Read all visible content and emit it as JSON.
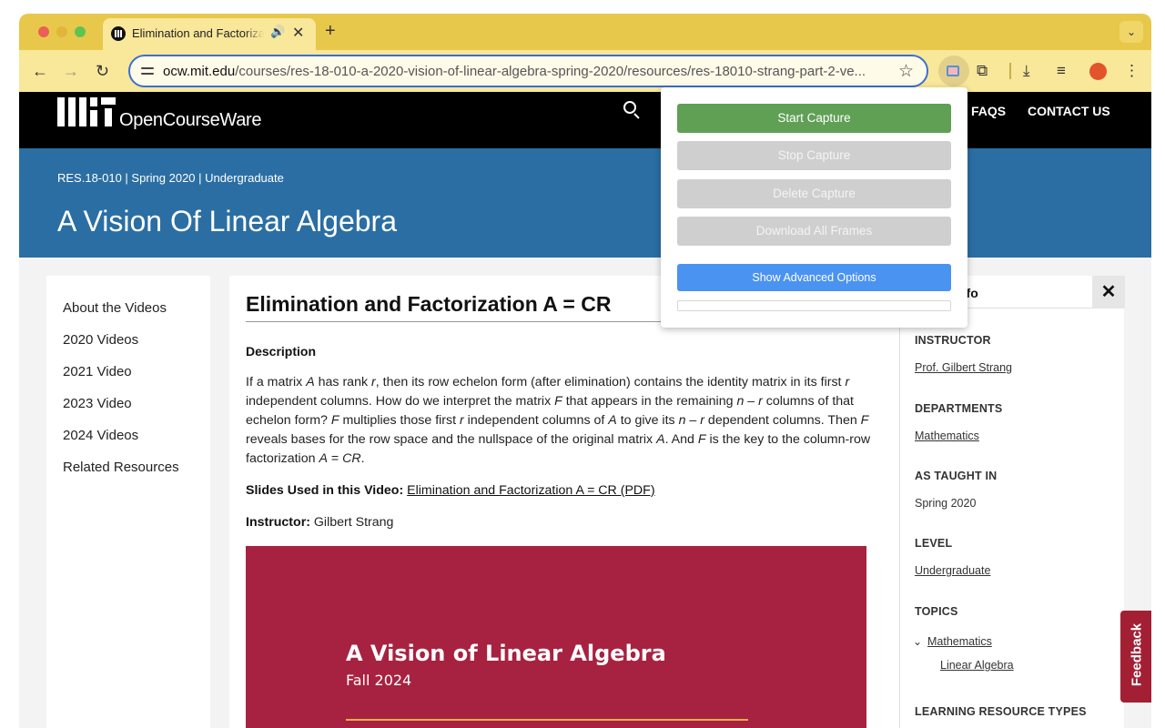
{
  "browser": {
    "tab_title": "Elimination and Factorization A = CR",
    "tab_audio_icon": "speaker-icon",
    "new_tab_label": "+",
    "tab_dropdown_label": "⌄",
    "url_domain": "ocw.mit.edu",
    "url_path": "/courses/res-18-010-a-2020-vision-of-linear-algebra-spring-2020/resources/res-18010-strang-part-2-ve...",
    "accent_color": "#e8c84a"
  },
  "site": {
    "brand": "OpenCourseWare",
    "nav": {
      "faqs": "FAQS",
      "contact": "CONTACT US"
    }
  },
  "course": {
    "meta": "RES.18-010 | Spring 2020 | Undergraduate",
    "title": "A Vision Of Linear Algebra"
  },
  "left_nav": {
    "items": [
      "About the Videos",
      "2020 Videos",
      "2021 Video",
      "2023 Video",
      "2024 Videos",
      "Related Resources"
    ]
  },
  "resource": {
    "title": "Elimination and Factorization A = CR",
    "description_heading": "Description",
    "slides_label": "Slides Used in this Video:",
    "slides_link": "Elimination and Factorization A = CR (PDF)",
    "instructor_label": "Instructor:",
    "instructor_name": "Gilbert Strang",
    "video": {
      "title": "A Vision of Linear Algebra",
      "subtitle": "Fall 2024",
      "bg_color": "#a72240"
    }
  },
  "sidebar": {
    "heading": "nfo",
    "close_label": "✕",
    "instructor_label": "INSTRUCTOR",
    "instructor": "Prof. Gilbert Strang",
    "departments_label": "DEPARTMENTS",
    "department": "Mathematics",
    "taught_label": "AS TAUGHT IN",
    "taught": "Spring 2020",
    "level_label": "LEVEL",
    "level": "Undergraduate",
    "topics_label": "TOPICS",
    "topic": "Mathematics",
    "subtopic": "Linear Algebra",
    "lrt_label": "LEARNING RESOURCE TYPES"
  },
  "feedback_label": "Feedback",
  "popup": {
    "start": "Start Capture",
    "stop": "Stop Capture",
    "delete": "Delete Capture",
    "download": "Download All Frames",
    "advanced": "Show Advanced Options",
    "progress": 0
  }
}
